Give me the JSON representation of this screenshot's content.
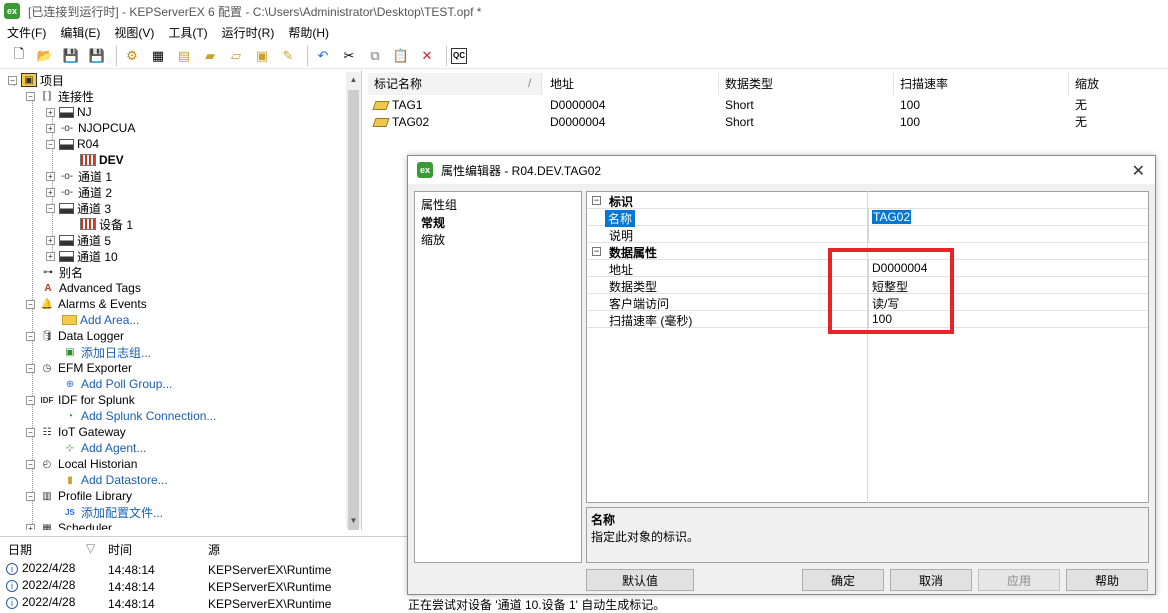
{
  "window": {
    "title": "[已连接到运行时] - KEPServerEX 6 配置 - C:\\Users\\Administrator\\Desktop\\TEST.opf *",
    "app_icon_text": "ex"
  },
  "menu": [
    "文件(F)",
    "编辑(E)",
    "视图(V)",
    "工具(T)",
    "运行时(R)",
    "帮助(H)"
  ],
  "toolbar_icons": [
    "new-file-icon",
    "open-folder-icon",
    "save-icon",
    "save-as-icon",
    "settings-gear-icon",
    "new-channel-icon",
    "new-device-icon",
    "new-tag-icon",
    "add-tag-group-icon",
    "bulk-tags-icon",
    "quick-client-icon",
    "undo-icon",
    "cut-icon",
    "copy-icon",
    "paste-icon",
    "delete-icon",
    "quick-client-qc-icon"
  ],
  "tree": {
    "root": "项目",
    "connectivity": "连接性",
    "channels": [
      "NJ",
      "NJOPCUA",
      "R04"
    ],
    "device_dev": "DEV",
    "channels2": [
      "通道 1",
      "通道 2",
      "通道 3"
    ],
    "device1": "设备 1",
    "channels3": [
      "通道 5",
      "通道 10"
    ],
    "alias": "别名",
    "advanced_tags": "Advanced Tags",
    "alarms": "Alarms & Events",
    "add_area": "Add Area...",
    "data_logger": "Data Logger",
    "add_log_group": "添加日志组...",
    "efm": "EFM Exporter",
    "add_poll_group": "Add Poll Group...",
    "idf": "IDF for Splunk",
    "add_splunk": "Add Splunk Connection...",
    "iot": "IoT Gateway",
    "add_agent": "Add Agent...",
    "historian": "Local Historian",
    "add_datastore": "Add Datastore...",
    "profile": "Profile Library",
    "add_profile": "添加配置文件...",
    "scheduler": "Scheduler"
  },
  "tag_table": {
    "headers": [
      "标记名称",
      "地址",
      "数据类型",
      "扫描速率",
      "缩放"
    ],
    "rows": [
      {
        "name": "TAG1",
        "address": "D0000004",
        "type": "Short",
        "rate": "100",
        "scaling": "无"
      },
      {
        "name": "TAG02",
        "address": "D0000004",
        "type": "Short",
        "rate": "100",
        "scaling": "无"
      }
    ]
  },
  "log": {
    "headers": [
      "日期",
      "时间",
      "源"
    ],
    "rows": [
      {
        "date": "2022/4/28",
        "time": "14:48:14",
        "source": "KEPServerEX\\Runtime"
      },
      {
        "date": "2022/4/28",
        "time": "14:48:14",
        "source": "KEPServerEX\\Runtime"
      },
      {
        "date": "2022/4/28",
        "time": "14:48:14",
        "source": "KEPServerEX\\Runtime"
      }
    ]
  },
  "status_message": "正在尝试对设备 '通道 10.设备 1' 自动生成标记。",
  "dialog": {
    "title": "属性编辑器 - R04.DEV.TAG02",
    "groups_header": "属性组",
    "groups": [
      "常规",
      "缩放"
    ],
    "sections": [
      {
        "title": "标识",
        "props": [
          {
            "key": "名称",
            "value": "TAG02"
          },
          {
            "key": "说明",
            "value": ""
          }
        ]
      },
      {
        "title": "数据属性",
        "props": [
          {
            "key": "地址",
            "value": "D0000004"
          },
          {
            "key": "数据类型",
            "value": "短整型"
          },
          {
            "key": "客户端访问",
            "value": "读/写"
          },
          {
            "key": "扫描速率 (毫秒)",
            "value": "100"
          }
        ]
      }
    ],
    "desc_title": "名称",
    "desc_text": "指定此对象的标识。",
    "buttons": {
      "defaults": "默认值",
      "ok": "确定",
      "cancel": "取消",
      "apply": "应用",
      "help": "帮助"
    }
  },
  "colors": {
    "selection": "#0078d7",
    "highlight_box": "#e8232a",
    "link": "#1a5fb4"
  }
}
